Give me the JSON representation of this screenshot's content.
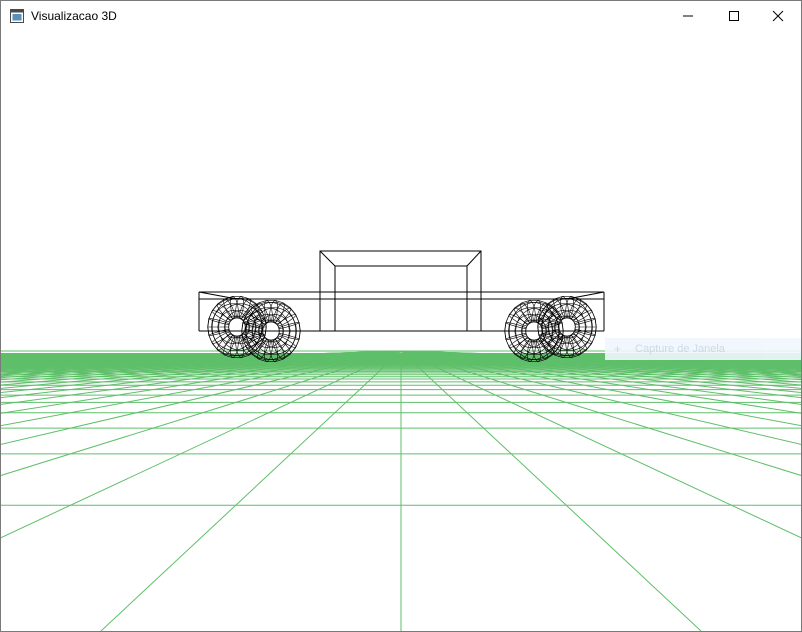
{
  "window": {
    "title": "Visualizacao 3D",
    "controls": {
      "minimize": "minimize-icon",
      "maximize": "maximize-icon",
      "close": "close-icon"
    }
  },
  "scene": {
    "background_color": "#ffffff",
    "grid_color": "#5fbf6a",
    "model_color": "#000000",
    "model": "wireframe-car",
    "wheel_count": 4
  },
  "overlay": {
    "capture_label": "Capture de Janela",
    "capture_icon": "plus-icon"
  }
}
